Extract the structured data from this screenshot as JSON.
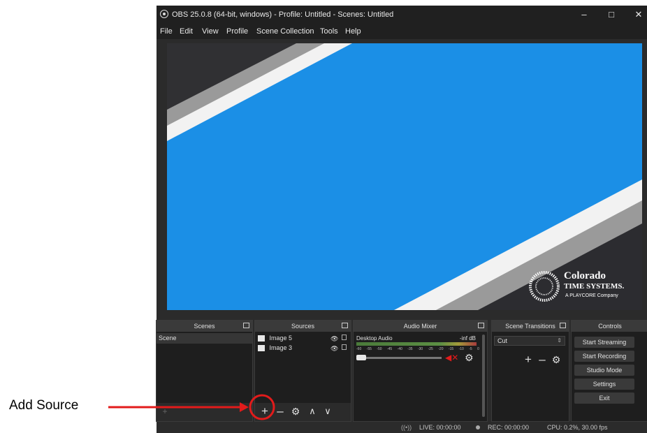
{
  "window": {
    "title": "OBS 25.0.8 (64-bit, windows) - Profile: Untitled - Scenes: Untitled",
    "minimize": "–",
    "maximize": "□",
    "close": "✕"
  },
  "menu": [
    "File",
    "Edit",
    "View",
    "Profile",
    "Scene Collection",
    "Tools",
    "Help"
  ],
  "preview": {
    "logo_line1": "Colorado",
    "logo_line2": "TIME SYSTEMS.",
    "logo_line3": "A PLAYCORE Company"
  },
  "scenes": {
    "header": "Scenes",
    "items": [
      "Scene"
    ]
  },
  "sources": {
    "header": "Sources",
    "items": [
      "Image 5",
      "Image 3"
    ]
  },
  "mixer": {
    "header": "Audio Mixer",
    "channel": "Desktop Audio",
    "level": "-inf dB",
    "ticks": [
      "-60",
      "-55",
      "-50",
      "-45",
      "-40",
      "-35",
      "-30",
      "-25",
      "-20",
      "-15",
      "-10",
      "-5",
      "0"
    ]
  },
  "transitions": {
    "header": "Scene Transitions",
    "selected": "Cut"
  },
  "controls": {
    "header": "Controls",
    "buttons": [
      "Start Streaming",
      "Start Recording",
      "Studio Mode",
      "Settings",
      "Exit"
    ]
  },
  "status": {
    "live": "LIVE: 00:00:00",
    "rec": "REC: 00:00:00",
    "cpu": "CPU: 0.2%, 30.00 fps"
  },
  "annotation": {
    "label": "Add Source"
  },
  "colors": {
    "accent_red": "#e21b1b",
    "preview_blue": "#1b8fe6"
  }
}
